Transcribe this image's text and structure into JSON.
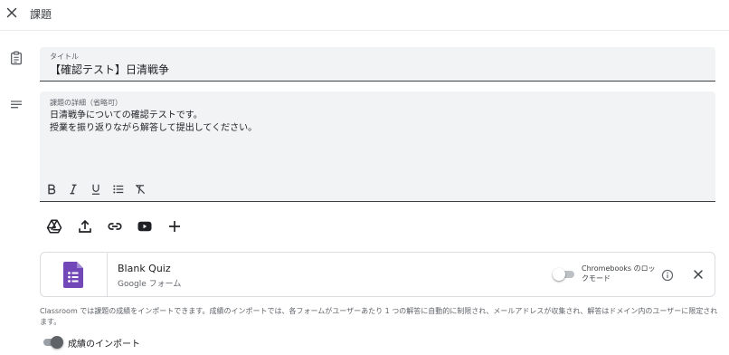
{
  "header": {
    "title": "課題",
    "close_icon": "close-icon"
  },
  "form": {
    "title_label": "タイトル",
    "title_value": "【確認テスト】日清戦争",
    "details_label": "課題の詳細（省略可）",
    "details_lines": [
      "日清戦争についての確認テストです。",
      "授業を振り返りながら解答して提出してください。"
    ]
  },
  "formatting_toolbar": {
    "buttons": [
      "bold-icon",
      "italic-icon",
      "underline-icon",
      "bulleted-list-icon",
      "clear-formatting-icon"
    ]
  },
  "attach_toolbar": {
    "buttons": [
      "google-drive-icon",
      "upload-icon",
      "link-icon",
      "youtube-icon",
      "add-icon"
    ]
  },
  "attachment": {
    "title": "Blank Quiz",
    "subtitle": "Google フォーム",
    "lock_mode_label": "Chromebooks のロックモード",
    "lock_mode_enabled": false,
    "icon": "google-forms-icon",
    "accent_color": "#7248b9"
  },
  "notice": "Classroom では課題の成績をインポートできます。成績のインポートでは、各フォームがユーザーあたり 1 つの解答に自動的に制限され、メールアドレスが収集され、解答はドメイン内のユーザーに限定されます。",
  "grade_import": {
    "label": "成績のインポート",
    "enabled": true
  }
}
